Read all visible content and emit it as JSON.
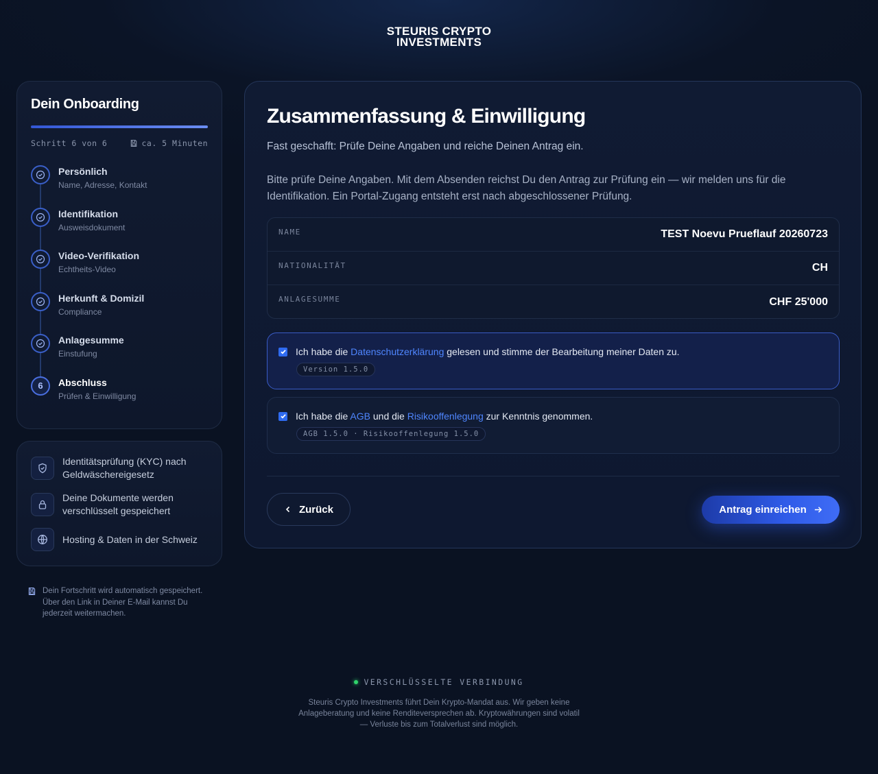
{
  "brand": {
    "line1": "STEURIS CRYPTO",
    "line2": "INVESTMENTS"
  },
  "sidebar": {
    "title": "Dein Onboarding",
    "progress": 1.0,
    "step_counter": "Schritt 6 von 6",
    "duration": "ca. 5 Minuten",
    "steps": [
      {
        "label": "Persönlich",
        "sub": "Name, Adresse, Kontakt",
        "status": "done"
      },
      {
        "label": "Identifikation",
        "sub": "Ausweisdokument",
        "status": "done"
      },
      {
        "label": "Video-Verifikation",
        "sub": "Echtheits-Video",
        "status": "done"
      },
      {
        "label": "Herkunft & Domizil",
        "sub": "Compliance",
        "status": "done"
      },
      {
        "label": "Anlagesumme",
        "sub": "Einstufung",
        "status": "done"
      },
      {
        "label": "Abschluss",
        "sub": "Prüfen & Einwilligung",
        "status": "current",
        "number": "6"
      }
    ],
    "trust": [
      {
        "icon": "shield-check-icon",
        "text": "Identitätsprüfung (KYC) nach Geldwäschereigesetz"
      },
      {
        "icon": "lock-icon",
        "text": "Deine Dokumente werden verschlüsselt gespeichert"
      },
      {
        "icon": "globe-icon",
        "text": "Hosting & Daten in der Schweiz"
      }
    ],
    "autosave": "Dein Fortschritt wird automatisch gespeichert. Über den Link in Deiner E-Mail kannst Du jederzeit weitermachen."
  },
  "main": {
    "title": "Zusammenfassung & Einwilligung",
    "lead": "Fast geschafft: Prüfe Deine Angaben und reiche Deinen Antrag ein.",
    "paragraph": "Bitte prüfe Deine Angaben. Mit dem Absenden reichst Du den Antrag zur Prüfung ein — wir melden uns für die Identifikation. Ein Portal-Zugang entsteht erst nach abgeschlossener Prüfung.",
    "summary": [
      {
        "key": "NAME",
        "value": "TEST Noevu Prueflauf 20260723"
      },
      {
        "key": "NATIONALITÄT",
        "value": "CH"
      },
      {
        "key": "ANLAGESUMME",
        "value": "CHF 25'000"
      }
    ],
    "consent1": {
      "checked": true,
      "prefix": "Ich habe die ",
      "link": "Datenschutzerklärung",
      "suffix": " gelesen und stimme der Bearbeitung meiner Daten zu.",
      "version": "Version 1.5.0"
    },
    "consent2": {
      "checked": true,
      "prefix": "Ich habe die ",
      "link1": "AGB",
      "middle": " und die ",
      "link2": "Risikooffenlegung",
      "suffix": " zur Kenntnis genommen.",
      "version": "AGB 1.5.0 · Risikooffenlegung 1.5.0"
    },
    "back_label": "Zurück",
    "submit_label": "Antrag einreichen"
  },
  "footer": {
    "secure": "VERSCHLÜSSELTE VERBINDUNG",
    "disclaimer": "Steuris Crypto Investments führt Dein Krypto-Mandat aus. Wir geben keine Anlageberatung und keine Renditeversprechen ab. Kryptowährungen sind volatil — Verluste bis zum Totalverlust sind möglich."
  },
  "colors": {
    "accent": "#2f5be8",
    "link": "#4f86ff",
    "secure_dot": "#2fd36b"
  }
}
